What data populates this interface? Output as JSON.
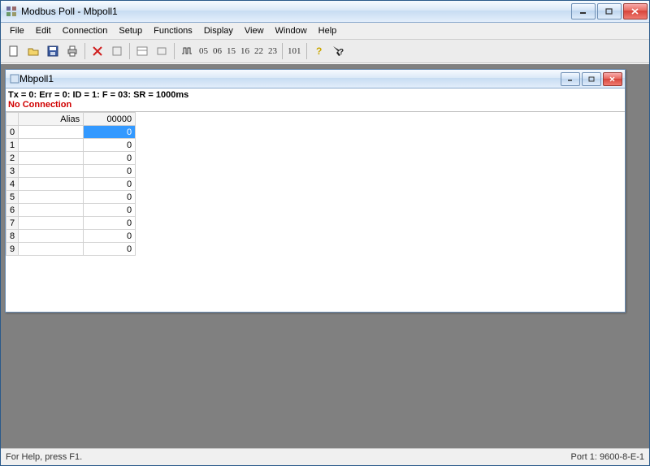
{
  "app": {
    "title": "Modbus Poll - Mbpoll1"
  },
  "menu": [
    "File",
    "Edit",
    "Connection",
    "Setup",
    "Functions",
    "Display",
    "View",
    "Window",
    "Help"
  ],
  "toolbar": {
    "codes": [
      "05",
      "06",
      "15",
      "16",
      "22",
      "23"
    ],
    "code_extra": "101"
  },
  "child": {
    "title": "Mbpoll1",
    "status_line": "Tx = 0: Err = 0: ID = 1: F = 03: SR = 1000ms",
    "no_conn": "No Connection",
    "columns": {
      "alias": "Alias",
      "addr": "00000"
    },
    "rows": [
      {
        "idx": "0",
        "alias": "",
        "val": "0",
        "selected": true
      },
      {
        "idx": "1",
        "alias": "",
        "val": "0",
        "selected": false
      },
      {
        "idx": "2",
        "alias": "",
        "val": "0",
        "selected": false
      },
      {
        "idx": "3",
        "alias": "",
        "val": "0",
        "selected": false
      },
      {
        "idx": "4",
        "alias": "",
        "val": "0",
        "selected": false
      },
      {
        "idx": "5",
        "alias": "",
        "val": "0",
        "selected": false
      },
      {
        "idx": "6",
        "alias": "",
        "val": "0",
        "selected": false
      },
      {
        "idx": "7",
        "alias": "",
        "val": "0",
        "selected": false
      },
      {
        "idx": "8",
        "alias": "",
        "val": "0",
        "selected": false
      },
      {
        "idx": "9",
        "alias": "",
        "val": "0",
        "selected": false
      }
    ]
  },
  "statusbar": {
    "help": "For Help, press F1.",
    "port": "Port 1: 9600-8-E-1"
  }
}
